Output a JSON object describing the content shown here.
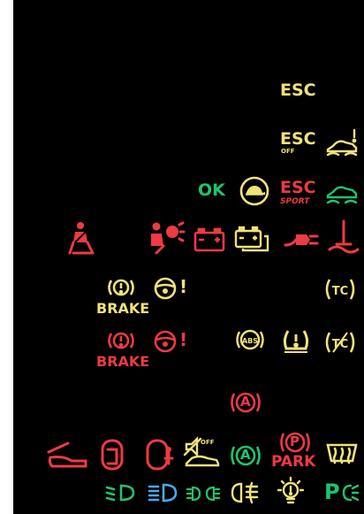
{
  "colors": {
    "background": "#000000",
    "red": "#ee3a43",
    "yellow": "#f0e27a",
    "green": "#20c46a",
    "blue": "#4aa7ec"
  },
  "labels": {
    "esc": "ESC",
    "esc_off_main": "ESC",
    "esc_off_sub": "OFF",
    "ok": "OK",
    "esc_sport_main": "ESC",
    "esc_sport_sub": "SPORT",
    "brake_yellow": "BRAKE",
    "brake_red": "BRAKE",
    "brake_excl_yellow": "(!)",
    "brake_excl_red": "(!)",
    "steering_excl_yellow": "!",
    "steering_excl_red": "!",
    "abs": "ABS",
    "tpms": "(!)",
    "tc": "TC",
    "auto_hold_a": "A",
    "auto_hold_a_green": "A",
    "start_stop_off": "OFF",
    "park_p": "P",
    "park": "PARK",
    "parking_light_p": "P"
  },
  "icons": {
    "esc_off_car": "car-skid-exclamation-icon",
    "turtle": "turtle-icon",
    "esc_sport_car": "car-skid-icon",
    "seatbelt": "seatbelt-icon",
    "airbag": "airbag-icon",
    "battery": "battery-icon",
    "battery_multi": "battery-pack-icon",
    "fuel_plug": "charging-plug-icon",
    "oil": "oil-level-icon",
    "steering": "steering-wheel-icon",
    "hood": "hood-open-icon",
    "door": "door-open-icon",
    "door_person": "door-person-icon",
    "start_stop": "start-stop-off-icon",
    "rear_defrost": "rear-defrost-icon",
    "low_beam": "low-beam-icon",
    "high_beam": "high-beam-icon",
    "sidelights": "sidelights-icon",
    "fog": "fog-light-icon",
    "bulb_failure": "bulb-failure-icon",
    "parking_light": "parking-light-icon"
  }
}
